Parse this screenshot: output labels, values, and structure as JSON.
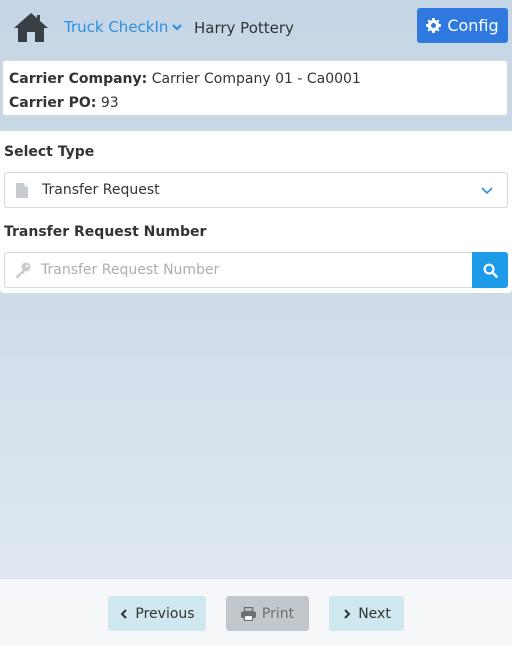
{
  "header": {
    "menu_label": "Truck CheckIn",
    "user_name": "Harry Pottery",
    "config_label": "Config"
  },
  "carrier": {
    "company_label": "Carrier Company:",
    "company_value": "Carrier Company 01 - Ca0001",
    "po_label": "Carrier PO:",
    "po_value": "93"
  },
  "form": {
    "select_type_label": "Select Type",
    "select_type_value": "Transfer Request",
    "transfer_number_label": "Transfer Request Number",
    "transfer_number_placeholder": "Transfer Request Number",
    "transfer_number_value": ""
  },
  "footer": {
    "previous_label": "Previous",
    "print_label": "Print",
    "next_label": "Next"
  },
  "colors": {
    "accent": "#2f78e0",
    "link": "#2d8fe0",
    "search_button": "#1e9be8",
    "nav_button": "#cfe7ee",
    "disabled_button": "#c2c7cc"
  },
  "icons": [
    "home-icon",
    "chevron-down-icon",
    "gear-icon",
    "file-icon",
    "key-icon",
    "search-icon",
    "chevron-left-icon",
    "print-icon",
    "chevron-right-icon"
  ]
}
